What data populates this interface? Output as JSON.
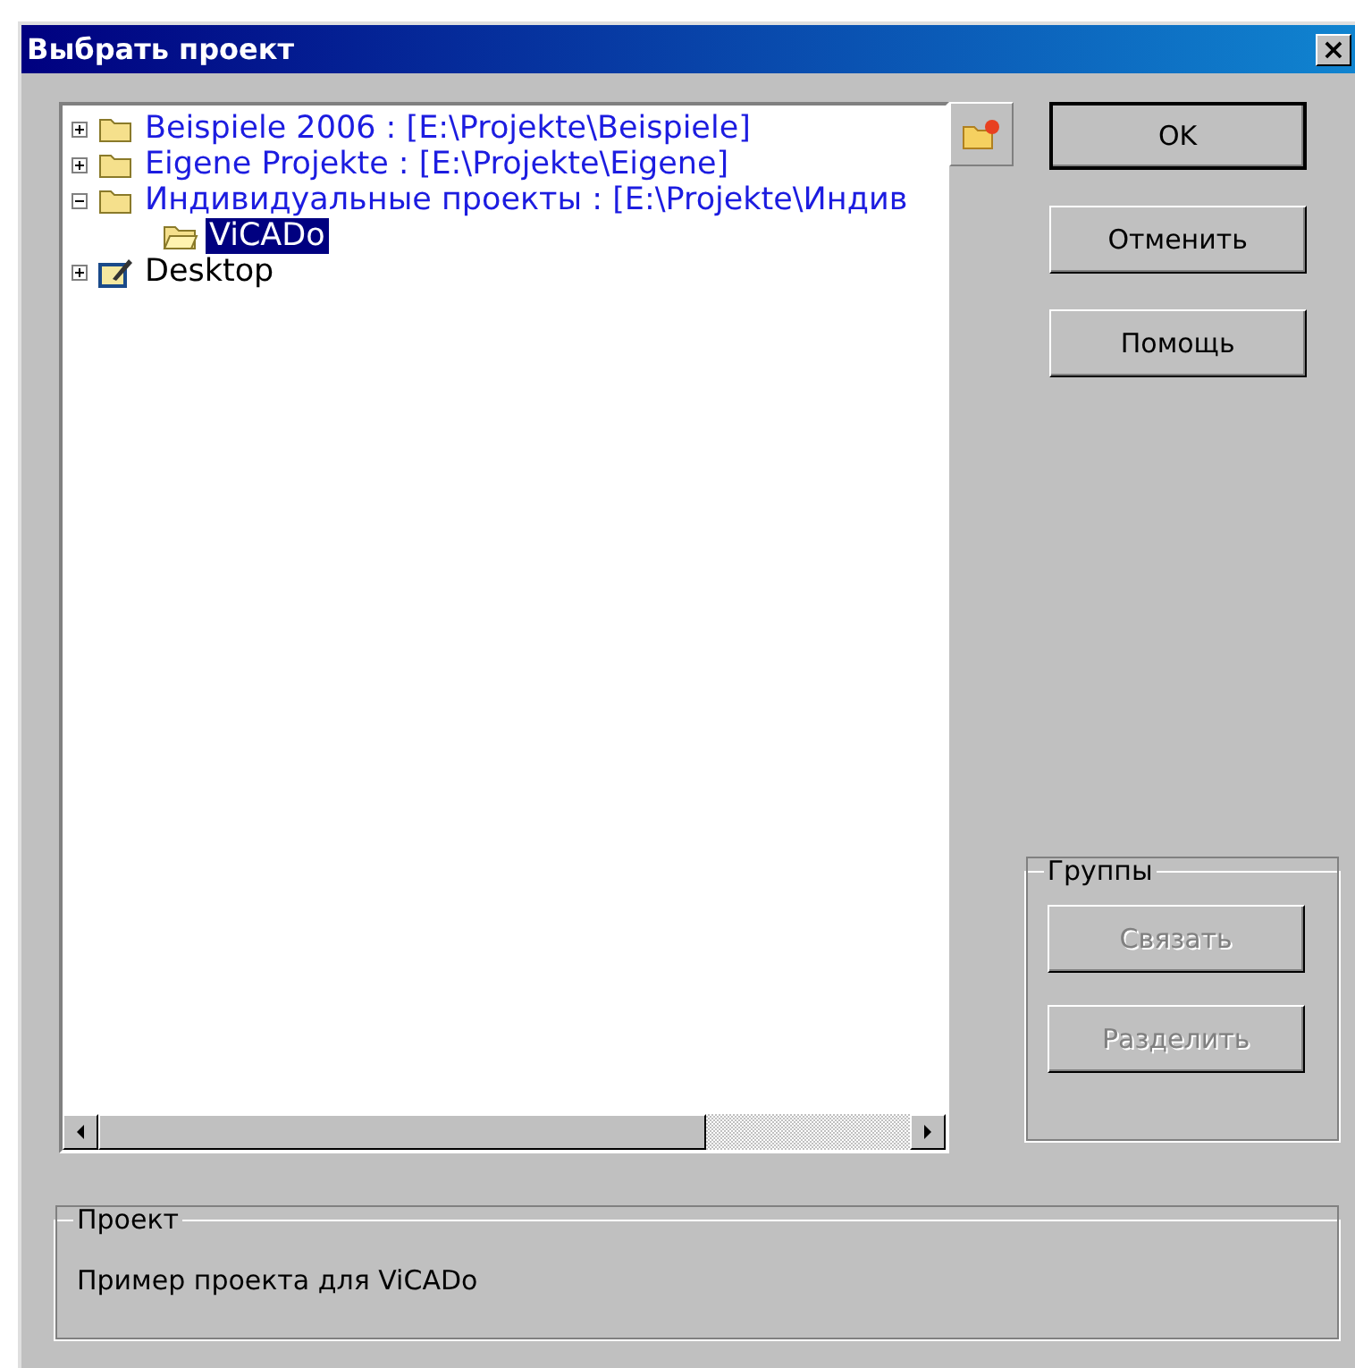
{
  "window": {
    "title": "Выбрать проект",
    "close": "×"
  },
  "tree": [
    {
      "label": "Beispiele 2006 : [E:\\Projekte\\Beispiele]",
      "kind": "project",
      "expanded": false,
      "selected": false
    },
    {
      "label": "Eigene Projekte : [E:\\Projekte\\Eigene]",
      "kind": "project",
      "expanded": false,
      "selected": false
    },
    {
      "label": "Индивидуальные проекты : [E:\\Projekte\\Индив",
      "kind": "project",
      "expanded": true,
      "selected": false,
      "children": [
        {
          "label": "ViCADo",
          "kind": "folder",
          "selected": true
        }
      ]
    },
    {
      "label": "Desktop",
      "kind": "desktop",
      "expanded": false,
      "selected": false
    }
  ],
  "buttons": [
    {
      "label": "OK",
      "default": true
    },
    {
      "label": "Отменить",
      "default": false
    },
    {
      "label": "Помощь",
      "default": false
    }
  ],
  "groups": {
    "title": "Группы",
    "buttons": [
      {
        "label": "Связать",
        "disabled": true
      },
      {
        "label": "Разделить",
        "disabled": true
      }
    ]
  },
  "project": {
    "title": "Проект",
    "description": "Пример проекта для ViCADo"
  }
}
